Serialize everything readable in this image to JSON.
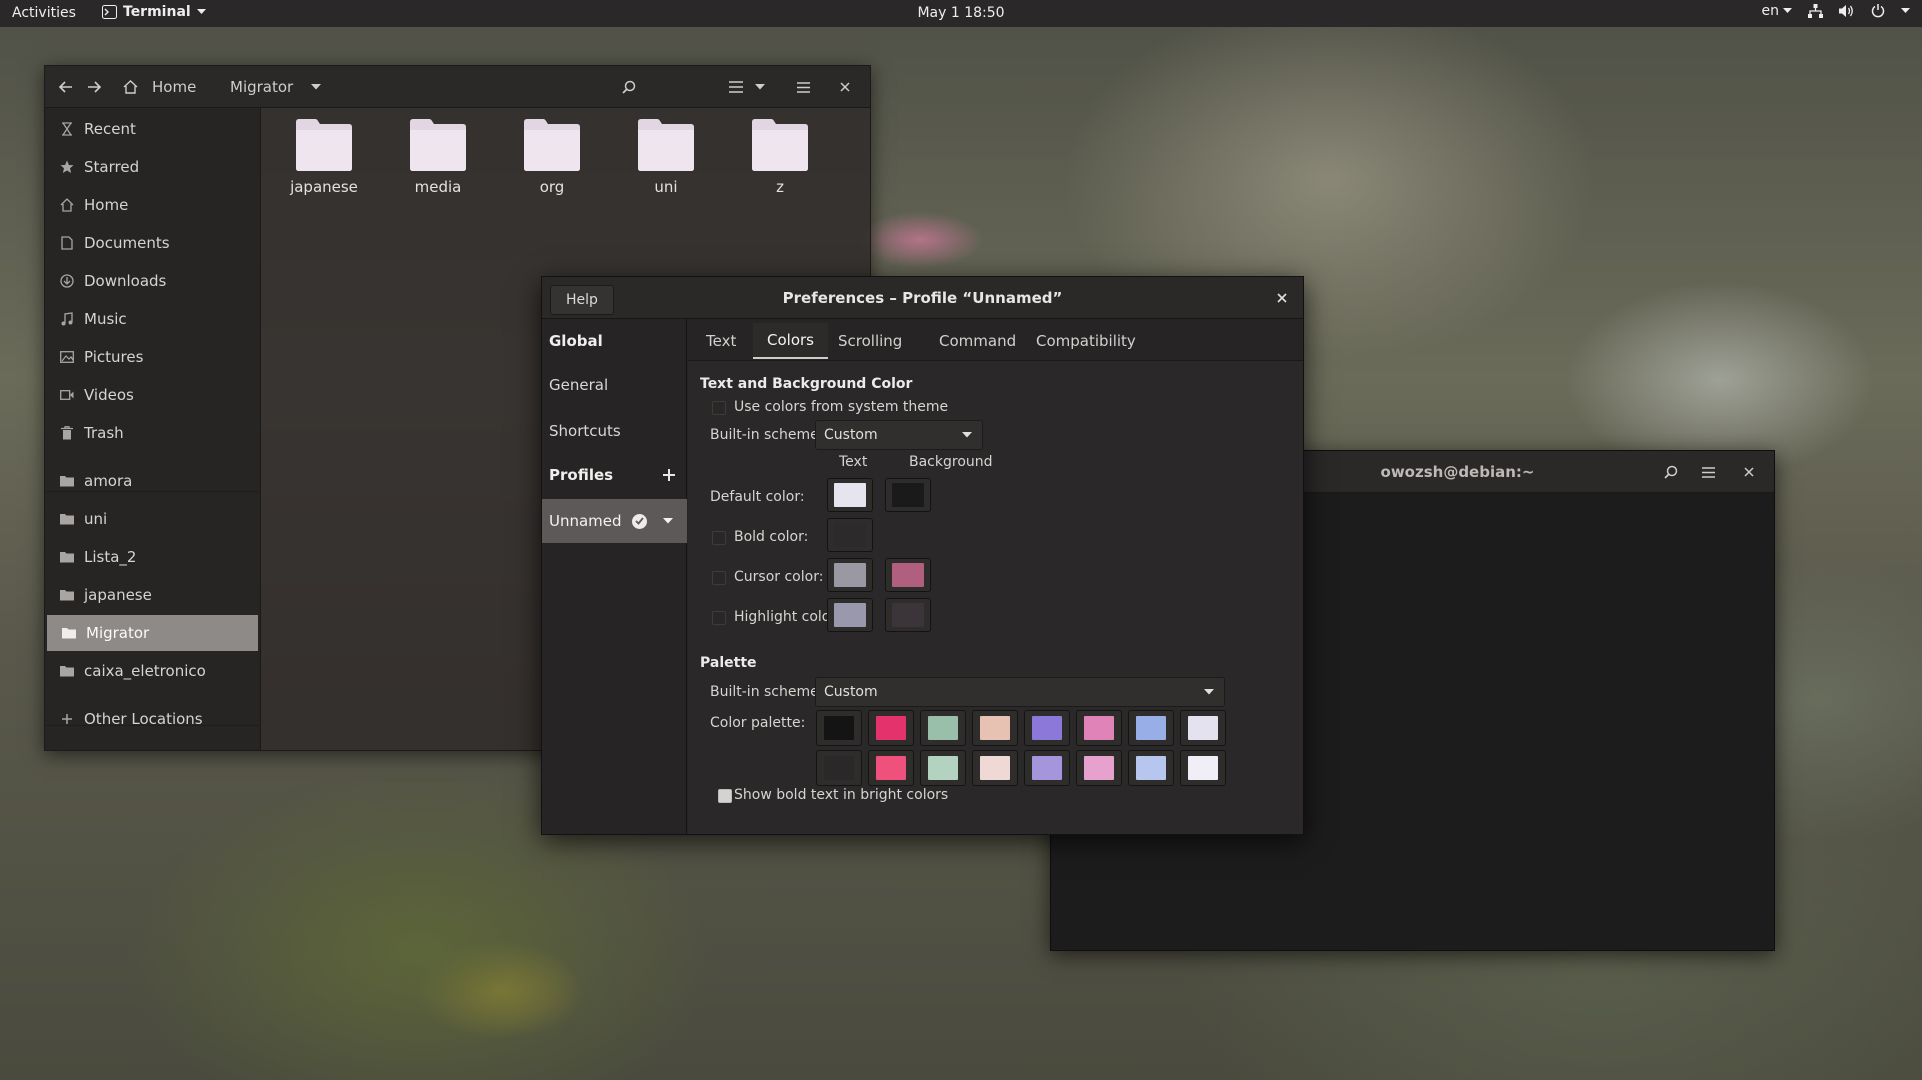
{
  "topbar": {
    "activities": "Activities",
    "app_name": "Terminal",
    "clock": "May 1  18:50",
    "lang": "en"
  },
  "file_manager": {
    "breadcrumb_home": "Home",
    "breadcrumb_current": "Migrator",
    "sidebar": [
      {
        "label": "Recent",
        "icon": "clock-icon"
      },
      {
        "label": "Starred",
        "icon": "star-icon"
      },
      {
        "label": "Home",
        "icon": "home-icon"
      },
      {
        "label": "Documents",
        "icon": "document-icon"
      },
      {
        "label": "Downloads",
        "icon": "download-icon"
      },
      {
        "label": "Music",
        "icon": "music-icon"
      },
      {
        "label": "Pictures",
        "icon": "picture-icon"
      },
      {
        "label": "Videos",
        "icon": "video-icon"
      },
      {
        "label": "Trash",
        "icon": "trash-icon"
      },
      {
        "label": "amora",
        "icon": "folder-icon"
      },
      {
        "label": "uni",
        "icon": "folder-icon"
      },
      {
        "label": "Lista_2",
        "icon": "folder-icon"
      },
      {
        "label": "japanese",
        "icon": "folder-icon"
      },
      {
        "label": "Migrator",
        "icon": "folder-icon"
      },
      {
        "label": "caixa_eletronico",
        "icon": "folder-icon"
      },
      {
        "label": "Other Locations",
        "icon": "plus-icon"
      }
    ],
    "folders": [
      "japanese",
      "media",
      "org",
      "uni",
      "z"
    ]
  },
  "terminal": {
    "title": "owozsh@debian:~"
  },
  "preferences": {
    "help": "Help",
    "title": "Preferences – Profile “Unnamed”",
    "sidebar": {
      "global": "Global",
      "general": "General",
      "shortcuts": "Shortcuts",
      "profiles": "Profiles",
      "profile_name": "Unnamed"
    },
    "tabs": [
      "Text",
      "Colors",
      "Scrolling",
      "Command",
      "Compatibility"
    ],
    "active_tab": "Colors",
    "text_bg_section": "Text and Background Color",
    "use_system_colors": "Use colors from system theme",
    "builtin_label": "Built-in schemes:",
    "builtin_value": "Custom",
    "col_text": "Text",
    "col_background": "Background",
    "default_color": "Default color:",
    "bold_color": "Bold color:",
    "cursor_color": "Cursor color:",
    "highlight_color": "Highlight color:",
    "colors": {
      "default_text": "#e6e4ef",
      "default_bg": "#1b1a1a",
      "bold": "#2c2a2b",
      "cursor_text": "#9a98a3",
      "cursor_bg": "#b05f7f",
      "highlight_text": "#9a98ac",
      "highlight_bg": "#3b3438"
    },
    "palette_section": "Palette",
    "palette_builtin_label": "Built-in schemes:",
    "palette_builtin_value": "Custom",
    "color_palette_label": "Color palette:",
    "palette_row1": [
      "#151414",
      "#e4326c",
      "#99bfaa",
      "#e7c2b3",
      "#8b78d8",
      "#e083b8",
      "#98aee6",
      "#e4e2ee"
    ],
    "palette_row2": [
      "#2a2828",
      "#f0507c",
      "#b4d2c0",
      "#efd9d5",
      "#a595dd",
      "#e6a1cf",
      "#b6c6ef",
      "#f0eff7"
    ],
    "bold_bright": "Show bold text in bright colors"
  }
}
